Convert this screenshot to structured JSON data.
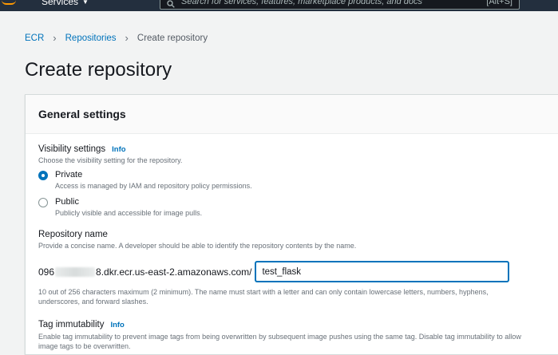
{
  "topnav": {
    "services_label": "Services",
    "search_placeholder": "Search for services, features, marketplace products, and docs",
    "search_shortcut": "[Alt+S]"
  },
  "breadcrumb": {
    "items": [
      "ECR",
      "Repositories"
    ],
    "current": "Create repository"
  },
  "page": {
    "title": "Create repository"
  },
  "general": {
    "title": "General settings",
    "visibility": {
      "label": "Visibility settings",
      "info": "Info",
      "description": "Choose the visibility setting for the repository.",
      "options": [
        {
          "title": "Private",
          "description": "Access is managed by IAM and repository policy permissions.",
          "selected": true
        },
        {
          "title": "Public",
          "description": "Publicly visible and accessible for image pulls.",
          "selected": false
        }
      ]
    },
    "repo_name": {
      "label": "Repository name",
      "description": "Provide a concise name. A developer should be able to identify the repository contents by the name.",
      "prefix_start": "096",
      "prefix_end": "8.dkr.ecr.us-east-2.amazonaws.com/",
      "value": "test_flask",
      "constraint": "10 out of 256 characters maximum (2 minimum). The name must start with a letter and can only contain lowercase letters, numbers, hyphens, underscores, and forward slashes."
    },
    "tag_immutability": {
      "label": "Tag immutability",
      "info": "Info",
      "description": "Enable tag immutability to prevent image tags from being overwritten by subsequent image pushes using the same tag. Disable tag immutability to allow image tags to be overwritten."
    }
  },
  "colors": {
    "nav_bg": "#232f3e",
    "link": "#0073bb",
    "accent": "#ff9900"
  }
}
